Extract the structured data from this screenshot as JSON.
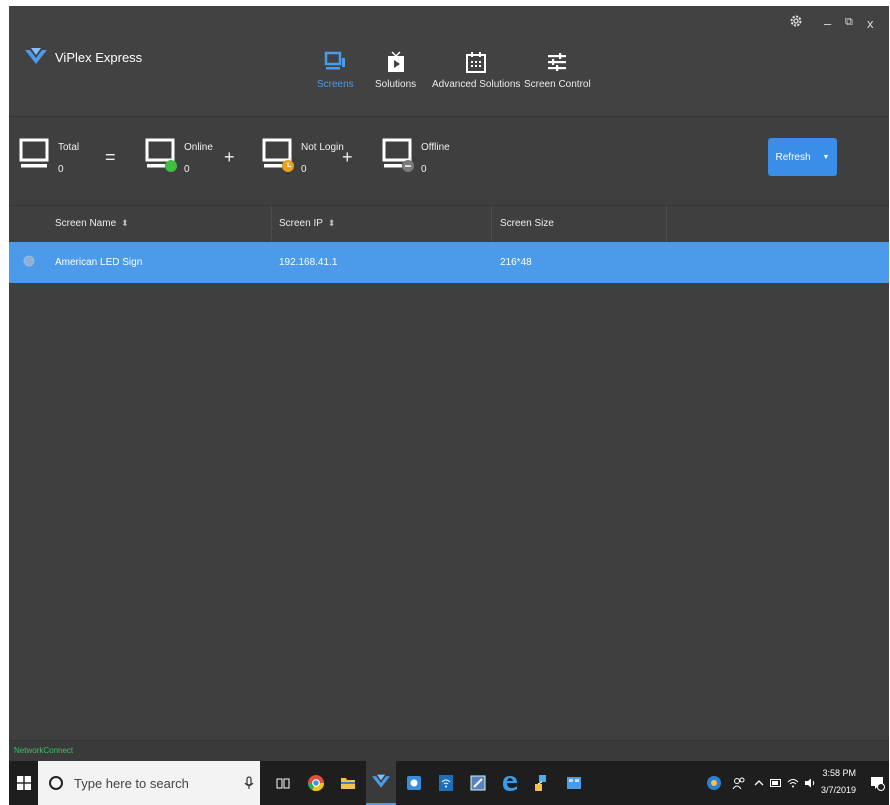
{
  "app": {
    "title": "ViPlex Express"
  },
  "nav": [
    {
      "label": "Screens",
      "icon": "screens-icon",
      "active": true
    },
    {
      "label": "Solutions",
      "icon": "solutions-icon"
    },
    {
      "label": "Advanced Solutions",
      "icon": "advanced-solutions-icon"
    },
    {
      "label": "Screen Control",
      "icon": "screen-control-icon"
    }
  ],
  "window_controls": {
    "minimize": "–",
    "restore": "⧉",
    "close": "x"
  },
  "stats": {
    "total": {
      "label": "Total",
      "count": "0"
    },
    "online": {
      "label": "Online",
      "count": "0"
    },
    "not_login": {
      "label": "Not Login",
      "count": "0"
    },
    "offline": {
      "label": "Offline",
      "count": "0"
    },
    "equals": "=",
    "plus": "+"
  },
  "refresh": {
    "label": "Refresh",
    "caret": "▼"
  },
  "table": {
    "columns": [
      "Screen Name",
      "Screen IP",
      "Screen Size"
    ],
    "sort_glyph": "⬍",
    "rows": [
      {
        "name": "American LED Sign",
        "ip": "192.168.41.1",
        "size": "216*48"
      }
    ]
  },
  "status": {
    "text": "NetworkConnect"
  },
  "taskbar": {
    "search_placeholder": "Type here to search",
    "time": "3:58 PM",
    "date": "3/7/2019"
  },
  "colors": {
    "accent": "#4b9bea",
    "online": "#3fbf3f",
    "not_login": "#e8a21f",
    "offline": "#7a7a7a"
  }
}
